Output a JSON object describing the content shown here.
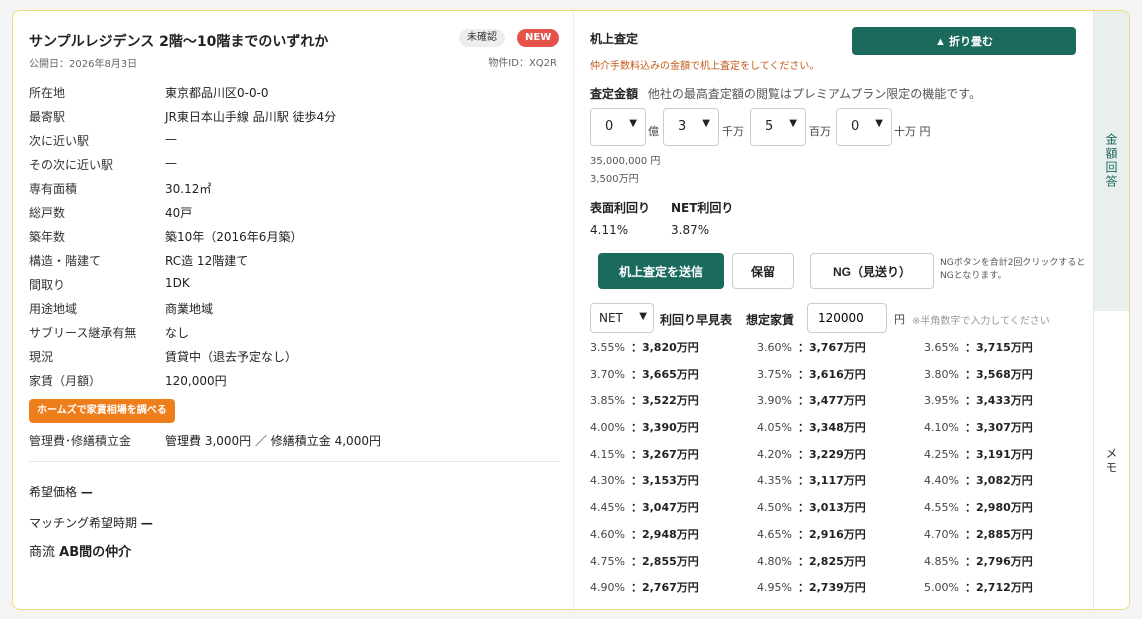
{
  "sidebar": {
    "answer_tab": "金額回答",
    "memo_tab": "メモ"
  },
  "property": {
    "title": "サンプルレジデンス 2階〜10階までのいずれか",
    "published": "公開日：2026年8月3日",
    "status_badge": "未確認",
    "new_badge": "NEW",
    "property_id": "物件ID：XQ2R",
    "details": [
      {
        "key": "所在地",
        "value": "東京都品川区0-0-0"
      },
      {
        "key": "最寄駅",
        "value": "JR東日本山手線 品川駅 徒歩4分"
      },
      {
        "key": "次に近い駅",
        "value": "—"
      },
      {
        "key": "その次に近い駅",
        "value": "—"
      },
      {
        "key": "専有面積",
        "value": "30.12㎡"
      },
      {
        "key": "総戸数",
        "value": "40戸"
      },
      {
        "key": "築年数",
        "value": "築10年（2016年6月築）"
      },
      {
        "key": "構造・階建て",
        "value": "RC造 12階建て"
      },
      {
        "key": "間取り",
        "value": "1DK"
      },
      {
        "key": "用途地域",
        "value": "商業地域"
      },
      {
        "key": "サブリース継承有無",
        "value": "なし"
      },
      {
        "key": "現況",
        "value": "賃貸中（退去予定なし）"
      },
      {
        "key": "家賃（月額）",
        "value": "120,000円"
      }
    ],
    "homes_button": "ホームズで家賃相場を調べる",
    "kanri": {
      "key": "管理費･修繕積立金",
      "value": "管理費 3,000円 ／ 修繕積立金 4,000円"
    },
    "kibou_label": "希望価格",
    "kibou_value": "—",
    "match_label": "マッチング希望時期",
    "match_value": "—",
    "shouryu_label": "商流",
    "shouryu_value": "AB間の仲介"
  },
  "appraisal": {
    "title": "机上査定",
    "note": "仲介手数料込みの金額で机上査定をしてください。",
    "fold_button": "▲ 折り畳む",
    "amount_label": "査定金額",
    "amount_note": "他社の最高査定額の閲覧はプレミアムプラン限定の機能です。",
    "selects": [
      {
        "value": "0",
        "unit": "億"
      },
      {
        "value": "3",
        "unit": "千万"
      },
      {
        "value": "5",
        "unit": "百万"
      },
      {
        "value": "0",
        "unit": "十万 円"
      }
    ],
    "amount_yen": "35,000,000 円",
    "amount_man": "3,500万円",
    "surface_yield_label": "表面利回り",
    "surface_yield": "4.11%",
    "net_yield_label": "NET利回り",
    "net_yield": "3.87%",
    "submit_button": "机上査定を送信",
    "hold_button": "保留",
    "ng_button": "NG（見送り）",
    "ng_note": "NGボタンを合計2回クリックするとNGとなります。",
    "net_select": "NET",
    "quick_table_label": "利回り早見表",
    "rent_label": "想定家賃",
    "rent_value": "120000",
    "rent_unit": "円",
    "rent_hint": "※半角数字で入力してください"
  },
  "yield_table": [
    [
      {
        "p": "3.55%",
        "a": "：3,820万円"
      },
      {
        "p": "3.60%",
        "a": "：3,767万円"
      },
      {
        "p": "3.65%",
        "a": "：3,715万円"
      }
    ],
    [
      {
        "p": "3.70%",
        "a": "：3,665万円"
      },
      {
        "p": "3.75%",
        "a": "：3,616万円"
      },
      {
        "p": "3.80%",
        "a": "：3,568万円"
      }
    ],
    [
      {
        "p": "3.85%",
        "a": "：3,522万円"
      },
      {
        "p": "3.90%",
        "a": "：3,477万円"
      },
      {
        "p": "3.95%",
        "a": "：3,433万円"
      }
    ],
    [
      {
        "p": "4.00%",
        "a": "：3,390万円"
      },
      {
        "p": "4.05%",
        "a": "：3,348万円"
      },
      {
        "p": "4.10%",
        "a": "：3,307万円"
      }
    ],
    [
      {
        "p": "4.15%",
        "a": "：3,267万円"
      },
      {
        "p": "4.20%",
        "a": "：3,229万円"
      },
      {
        "p": "4.25%",
        "a": "：3,191万円"
      }
    ],
    [
      {
        "p": "4.30%",
        "a": "：3,153万円"
      },
      {
        "p": "4.35%",
        "a": "：3,117万円"
      },
      {
        "p": "4.40%",
        "a": "：3,082万円"
      }
    ],
    [
      {
        "p": "4.45%",
        "a": "：3,047万円"
      },
      {
        "p": "4.50%",
        "a": "：3,013万円"
      },
      {
        "p": "4.55%",
        "a": "：2,980万円"
      }
    ],
    [
      {
        "p": "4.60%",
        "a": "：2,948万円"
      },
      {
        "p": "4.65%",
        "a": "：2,916万円"
      },
      {
        "p": "4.70%",
        "a": "：2,885万円"
      }
    ],
    [
      {
        "p": "4.75%",
        "a": "：2,855万円"
      },
      {
        "p": "4.80%",
        "a": "：2,825万円"
      },
      {
        "p": "4.85%",
        "a": "：2,796万円"
      }
    ],
    [
      {
        "p": "4.90%",
        "a": "：2,767万円"
      },
      {
        "p": "4.95%",
        "a": "：2,739万円"
      },
      {
        "p": "5.00%",
        "a": "：2,712万円"
      }
    ]
  ]
}
